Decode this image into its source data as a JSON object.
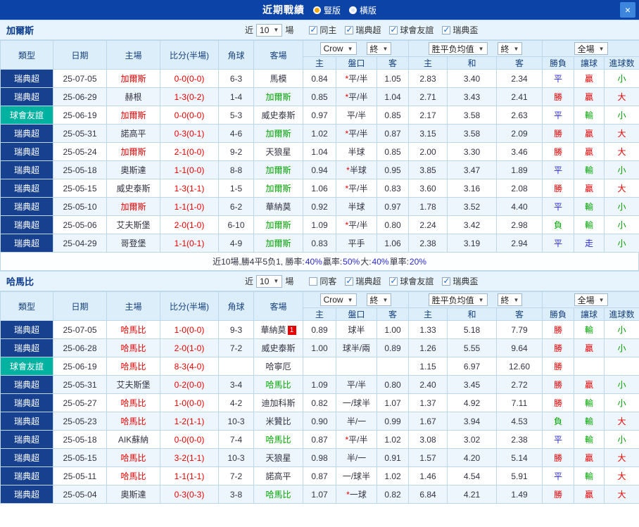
{
  "colors": {
    "titlebar_bg": "#0b43a6",
    "accent_red": "#e60000",
    "accent_green": "#00a400",
    "accent_blue": "#2a2ad0",
    "league_badge_bg": "#17418f",
    "friendly_badge_bg": "#01b2a1",
    "header_bg": "#dceefa",
    "row_alt_bg": "#eef6fd"
  },
  "titlebar": {
    "title": "近期戰績",
    "layout_vertical": "豎版",
    "layout_horizontal": "橫版",
    "close": "×"
  },
  "filters": {
    "near": "近",
    "count": "10",
    "matches": "場",
    "leagues": [
      "瑞典超",
      "球會友誼",
      "瑞典盃"
    ],
    "leagues_checked": [
      true,
      true,
      true
    ]
  },
  "table_controls": {
    "bookmaker": "Crow",
    "final": "終",
    "avg": "胜平负均值",
    "full": "全場",
    "arrow": "▼"
  },
  "columns": {
    "type": "類型",
    "date": "日期",
    "home": "主場",
    "score": "比分(半場)",
    "corner": "角球",
    "away": "客場",
    "odds_home": "主",
    "handicap": "盤口",
    "odds_away": "客",
    "avg_home": "主",
    "avg_draw": "和",
    "avg_away": "客",
    "result": "勝負",
    "let_ball": "讓球",
    "goals": "進球数"
  },
  "sections": [
    {
      "team": "加爾斯",
      "same_label": "同主",
      "same_checked": true,
      "rows": [
        {
          "league": "瑞典超",
          "lcls": "league",
          "date": "25-07-05",
          "home": "加爾斯",
          "hcls": "red",
          "score": "0-0(0-0)",
          "corner": "6-3",
          "away": "馬模",
          "acls": "dark",
          "badge": "",
          "oh": "0.84",
          "hc": "*平/半",
          "oa": "1.05",
          "ah": "2.83",
          "ad": "3.40",
          "aa": "2.34",
          "res": "平",
          "rcls": "blue",
          "let": "贏",
          "letcls": "red",
          "goal": "小",
          "gcls": "green"
        },
        {
          "league": "瑞典超",
          "lcls": "league",
          "date": "25-06-29",
          "home": "赫根",
          "hcls": "dark",
          "score": "1-3(0-2)",
          "corner": "1-4",
          "away": "加爾斯",
          "acls": "green",
          "badge": "",
          "oh": "0.85",
          "hc": "*平/半",
          "oa": "1.04",
          "ah": "2.71",
          "ad": "3.43",
          "aa": "2.41",
          "res": "勝",
          "rcls": "red",
          "let": "贏",
          "letcls": "red",
          "goal": "大",
          "gcls": "red"
        },
        {
          "league": "球會友誼",
          "lcls": "friendly",
          "date": "25-06-19",
          "home": "加爾斯",
          "hcls": "red",
          "score": "0-0(0-0)",
          "corner": "5-3",
          "away": "威史泰斯",
          "acls": "dark",
          "badge": "",
          "oh": "0.97",
          "hc": "平/半",
          "oa": "0.85",
          "ah": "2.17",
          "ad": "3.58",
          "aa": "2.63",
          "res": "平",
          "rcls": "blue",
          "let": "輸",
          "letcls": "green",
          "goal": "小",
          "gcls": "green"
        },
        {
          "league": "瑞典超",
          "lcls": "league",
          "date": "25-05-31",
          "home": "諾高平",
          "hcls": "dark",
          "score": "0-3(0-1)",
          "corner": "4-6",
          "away": "加爾斯",
          "acls": "green",
          "badge": "",
          "oh": "1.02",
          "hc": "*平/半",
          "oa": "0.87",
          "ah": "3.15",
          "ad": "3.58",
          "aa": "2.09",
          "res": "勝",
          "rcls": "red",
          "let": "贏",
          "letcls": "red",
          "goal": "大",
          "gcls": "red"
        },
        {
          "league": "瑞典超",
          "lcls": "league",
          "date": "25-05-24",
          "home": "加爾斯",
          "hcls": "red",
          "score": "2-1(0-0)",
          "corner": "9-2",
          "away": "天狼星",
          "acls": "dark",
          "badge": "",
          "oh": "1.04",
          "hc": "半球",
          "oa": "0.85",
          "ah": "2.00",
          "ad": "3.30",
          "aa": "3.46",
          "res": "勝",
          "rcls": "red",
          "let": "贏",
          "letcls": "red",
          "goal": "大",
          "gcls": "red"
        },
        {
          "league": "瑞典超",
          "lcls": "league",
          "date": "25-05-18",
          "home": "奧斯達",
          "hcls": "dark",
          "score": "1-1(0-0)",
          "corner": "8-8",
          "away": "加爾斯",
          "acls": "green",
          "badge": "",
          "oh": "0.94",
          "hc": "*半球",
          "oa": "0.95",
          "ah": "3.85",
          "ad": "3.47",
          "aa": "1.89",
          "res": "平",
          "rcls": "blue",
          "let": "輸",
          "letcls": "green",
          "goal": "小",
          "gcls": "green"
        },
        {
          "league": "瑞典超",
          "lcls": "league",
          "date": "25-05-15",
          "home": "威史泰斯",
          "hcls": "dark",
          "score": "1-3(1-1)",
          "corner": "1-5",
          "away": "加爾斯",
          "acls": "green",
          "badge": "",
          "oh": "1.06",
          "hc": "*平/半",
          "oa": "0.83",
          "ah": "3.60",
          "ad": "3.16",
          "aa": "2.08",
          "res": "勝",
          "rcls": "red",
          "let": "贏",
          "letcls": "red",
          "goal": "大",
          "gcls": "red"
        },
        {
          "league": "瑞典超",
          "lcls": "league",
          "date": "25-05-10",
          "home": "加爾斯",
          "hcls": "red",
          "score": "1-1(1-0)",
          "corner": "6-2",
          "away": "華納莫",
          "acls": "dark",
          "badge": "",
          "oh": "0.92",
          "hc": "半球",
          "oa": "0.97",
          "ah": "1.78",
          "ad": "3.52",
          "aa": "4.40",
          "res": "平",
          "rcls": "blue",
          "let": "輸",
          "letcls": "green",
          "goal": "小",
          "gcls": "green"
        },
        {
          "league": "瑞典超",
          "lcls": "league",
          "date": "25-05-06",
          "home": "艾夫斯堡",
          "hcls": "dark",
          "score": "2-0(1-0)",
          "corner": "6-10",
          "away": "加爾斯",
          "acls": "green",
          "badge": "",
          "oh": "1.09",
          "hc": "*平/半",
          "oa": "0.80",
          "ah": "2.24",
          "ad": "3.42",
          "aa": "2.98",
          "res": "負",
          "rcls": "green",
          "let": "輸",
          "letcls": "green",
          "goal": "小",
          "gcls": "green"
        },
        {
          "league": "瑞典超",
          "lcls": "league",
          "date": "25-04-29",
          "home": "哥登堡",
          "hcls": "dark",
          "score": "1-1(0-1)",
          "corner": "4-9",
          "away": "加爾斯",
          "acls": "green",
          "badge": "",
          "oh": "0.83",
          "hc": "平手",
          "oa": "1.06",
          "ah": "2.38",
          "ad": "3.19",
          "aa": "2.94",
          "res": "平",
          "rcls": "blue",
          "let": "走",
          "letcls": "blue",
          "goal": "小",
          "gcls": "green"
        }
      ],
      "summary": [
        {
          "t": "近10場,勝4平5负1, 勝率:",
          "c": "dark"
        },
        {
          "t": "40%",
          "c": "blue"
        },
        {
          "t": " 贏率:",
          "c": "dark"
        },
        {
          "t": "50%",
          "c": "blue"
        },
        {
          "t": " 大:",
          "c": "dark"
        },
        {
          "t": "40%",
          "c": "blue"
        },
        {
          "t": " 單率:",
          "c": "dark"
        },
        {
          "t": "20%",
          "c": "blue"
        }
      ]
    },
    {
      "team": "哈馬比",
      "same_label": "同客",
      "same_checked": false,
      "rows": [
        {
          "league": "瑞典超",
          "lcls": "league",
          "date": "25-07-05",
          "home": "哈馬比",
          "hcls": "red",
          "score": "1-0(0-0)",
          "corner": "9-3",
          "away": "華納莫",
          "acls": "dark",
          "badge": "1",
          "oh": "0.89",
          "hc": "球半",
          "oa": "1.00",
          "ah": "1.33",
          "ad": "5.18",
          "aa": "7.79",
          "res": "勝",
          "rcls": "red",
          "let": "輸",
          "letcls": "green",
          "goal": "小",
          "gcls": "green"
        },
        {
          "league": "瑞典超",
          "lcls": "league",
          "date": "25-06-28",
          "home": "哈馬比",
          "hcls": "red",
          "score": "2-0(1-0)",
          "corner": "7-2",
          "away": "威史泰斯",
          "acls": "dark",
          "badge": "",
          "oh": "1.00",
          "hc": "球半/兩",
          "oa": "0.89",
          "ah": "1.26",
          "ad": "5.55",
          "aa": "9.64",
          "res": "勝",
          "rcls": "red",
          "let": "贏",
          "letcls": "red",
          "goal": "小",
          "gcls": "green"
        },
        {
          "league": "球會友誼",
          "lcls": "friendly",
          "date": "25-06-19",
          "home": "哈馬比",
          "hcls": "red",
          "score": "8-3(4-0)",
          "corner": "",
          "away": "哈寧厄",
          "acls": "dark",
          "badge": "",
          "oh": "",
          "hc": "",
          "oa": "",
          "ah": "1.15",
          "ad": "6.97",
          "aa": "12.60",
          "res": "勝",
          "rcls": "red",
          "let": "",
          "letcls": "dark",
          "goal": "",
          "gcls": "dark"
        },
        {
          "league": "瑞典超",
          "lcls": "league",
          "date": "25-05-31",
          "home": "艾夫斯堡",
          "hcls": "dark",
          "score": "0-2(0-0)",
          "corner": "3-4",
          "away": "哈馬比",
          "acls": "green",
          "badge": "",
          "oh": "1.09",
          "hc": "平/半",
          "oa": "0.80",
          "ah": "2.40",
          "ad": "3.45",
          "aa": "2.72",
          "res": "勝",
          "rcls": "red",
          "let": "贏",
          "letcls": "red",
          "goal": "小",
          "gcls": "green"
        },
        {
          "league": "瑞典超",
          "lcls": "league",
          "date": "25-05-27",
          "home": "哈馬比",
          "hcls": "red",
          "score": "1-0(0-0)",
          "corner": "4-2",
          "away": "迪加科斯",
          "acls": "dark",
          "badge": "",
          "oh": "0.82",
          "hc": "一/球半",
          "oa": "1.07",
          "ah": "1.37",
          "ad": "4.92",
          "aa": "7.11",
          "res": "勝",
          "rcls": "red",
          "let": "輸",
          "letcls": "green",
          "goal": "小",
          "gcls": "green"
        },
        {
          "league": "瑞典超",
          "lcls": "league",
          "date": "25-05-23",
          "home": "哈馬比",
          "hcls": "red",
          "score": "1-2(1-1)",
          "corner": "10-3",
          "away": "米贊比",
          "acls": "dark",
          "badge": "",
          "oh": "0.90",
          "hc": "半/一",
          "oa": "0.99",
          "ah": "1.67",
          "ad": "3.94",
          "aa": "4.53",
          "res": "負",
          "rcls": "green",
          "let": "輸",
          "letcls": "green",
          "goal": "大",
          "gcls": "red"
        },
        {
          "league": "瑞典超",
          "lcls": "league",
          "date": "25-05-18",
          "home": "AIK蘇納",
          "hcls": "dark",
          "score": "0-0(0-0)",
          "corner": "7-4",
          "away": "哈馬比",
          "acls": "green",
          "badge": "",
          "oh": "0.87",
          "hc": "*平/半",
          "oa": "1.02",
          "ah": "3.08",
          "ad": "3.02",
          "aa": "2.38",
          "res": "平",
          "rcls": "blue",
          "let": "輸",
          "letcls": "green",
          "goal": "小",
          "gcls": "green"
        },
        {
          "league": "瑞典超",
          "lcls": "league",
          "date": "25-05-15",
          "home": "哈馬比",
          "hcls": "red",
          "score": "3-2(1-1)",
          "corner": "10-3",
          "away": "天狼星",
          "acls": "dark",
          "badge": "",
          "oh": "0.98",
          "hc": "半/一",
          "oa": "0.91",
          "ah": "1.57",
          "ad": "4.20",
          "aa": "5.14",
          "res": "勝",
          "rcls": "red",
          "let": "贏",
          "letcls": "red",
          "goal": "大",
          "gcls": "red"
        },
        {
          "league": "瑞典超",
          "lcls": "league",
          "date": "25-05-11",
          "home": "哈馬比",
          "hcls": "red",
          "score": "1-1(1-1)",
          "corner": "7-2",
          "away": "諾高平",
          "acls": "dark",
          "badge": "",
          "oh": "0.87",
          "hc": "一/球半",
          "oa": "1.02",
          "ah": "1.46",
          "ad": "4.54",
          "aa": "5.91",
          "res": "平",
          "rcls": "blue",
          "let": "輸",
          "letcls": "green",
          "goal": "大",
          "gcls": "red"
        },
        {
          "league": "瑞典超",
          "lcls": "league",
          "date": "25-05-04",
          "home": "奧斯達",
          "hcls": "dark",
          "score": "0-3(0-3)",
          "corner": "3-8",
          "away": "哈馬比",
          "acls": "green",
          "badge": "",
          "oh": "1.07",
          "hc": "*一球",
          "oa": "0.82",
          "ah": "6.84",
          "ad": "4.21",
          "aa": "1.49",
          "res": "勝",
          "rcls": "red",
          "let": "贏",
          "letcls": "red",
          "goal": "大",
          "gcls": "red"
        }
      ]
    }
  ]
}
